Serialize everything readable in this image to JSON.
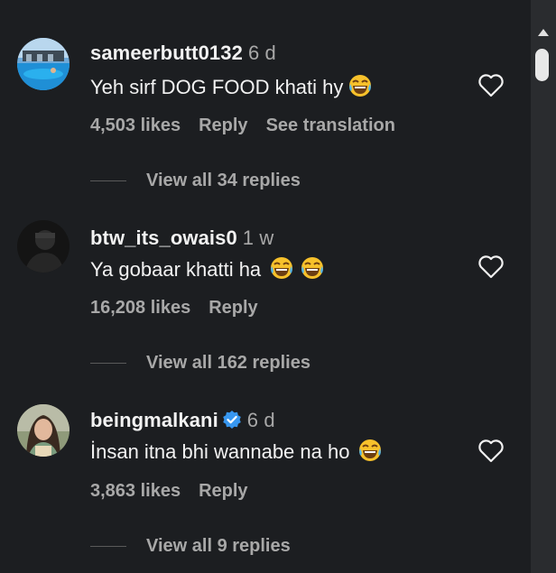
{
  "comments": [
    {
      "username": "sameerbutt0132",
      "time": "6 d",
      "text": "Yeh sirf DOG FOOD khati hy",
      "likes": "4,503 likes",
      "reply": "Reply",
      "translate": "See translation",
      "view_replies": "View all 34 replies"
    },
    {
      "username": "btw_its_owais0",
      "time": "1 w",
      "text": "Ya gobaar khatti ha",
      "likes": "16,208 likes",
      "reply": "Reply",
      "view_replies": "View all 162 replies"
    },
    {
      "username": "beingmalkani",
      "time": "6 d",
      "text": "İnsan itna bhi wannabe na ho",
      "likes": "3,863 likes",
      "reply": "Reply",
      "view_replies": "View all 9 replies"
    }
  ],
  "icons": {
    "like": "heart-outline-icon",
    "emoji": "laughing-tears-emoji",
    "verified": "verified-badge-icon"
  },
  "colors": {
    "background": "#1c1e21",
    "muted_text": "#a8a8a8",
    "verified_blue": "#3897f0",
    "emoji_yellow": "#f7c12b"
  }
}
